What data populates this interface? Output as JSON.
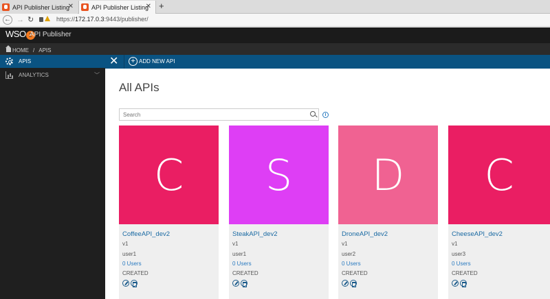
{
  "browser": {
    "tabs": [
      {
        "title": "API Publisher Listing",
        "active": false
      },
      {
        "title": "API Publisher Listing",
        "active": true
      }
    ],
    "url_prefix": "https://",
    "url_host": "172.17.0.3",
    "url_rest": ":9443/publisher/"
  },
  "header": {
    "logo_text": "WSO",
    "logo_badge": "2",
    "title": "API Publisher"
  },
  "breadcrumb": {
    "home": "HOME",
    "separator": "/",
    "current": "APIS"
  },
  "sidebar": {
    "items": [
      {
        "label": "APIS",
        "icon": "gear-icon",
        "active": true
      },
      {
        "label": "ANALYTICS",
        "icon": "bar-chart-icon",
        "active": false
      }
    ]
  },
  "toolbar": {
    "close_symbol": "✕",
    "add_label": "ADD NEW API"
  },
  "main": {
    "title": "All APIs",
    "search_placeholder": "Search"
  },
  "apis": [
    {
      "letter": "C",
      "name": "CoffeeAPI_dev2",
      "version": "v1",
      "provider": "user1",
      "users": "0 Users",
      "status": "CREATED",
      "color": "#ea1e63"
    },
    {
      "letter": "S",
      "name": "SteakAPI_dev2",
      "version": "v1",
      "provider": "user1",
      "users": "0 Users",
      "status": "CREATED",
      "color": "#de3ef5"
    },
    {
      "letter": "D",
      "name": "DroneAPI_dev2",
      "version": "v1",
      "provider": "user2",
      "users": "0 Users",
      "status": "CREATED",
      "color": "#f06292"
    },
    {
      "letter": "C",
      "name": "CheeseAPI_dev2",
      "version": "v1",
      "provider": "user3",
      "users": "0 Users",
      "status": "CREATED",
      "color": "#ea1e63"
    }
  ]
}
